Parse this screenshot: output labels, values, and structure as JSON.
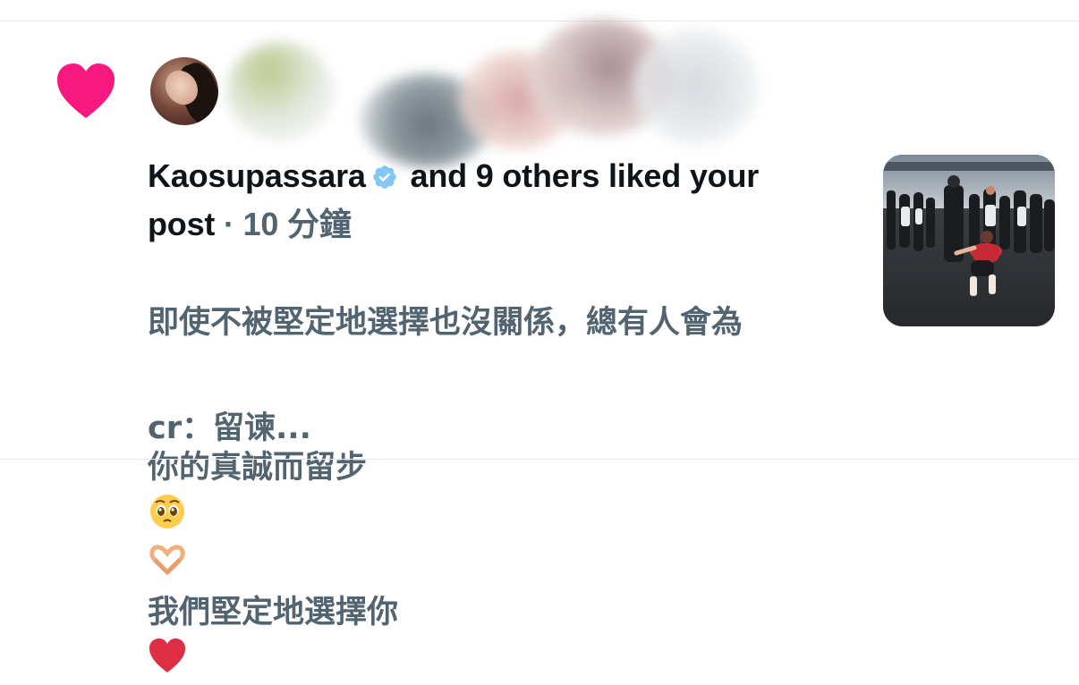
{
  "notification": {
    "type_icon": "heart-icon",
    "accent_color": "#f91880",
    "liker_name": "Kaosupassara",
    "action_text": "and 9 others liked your post",
    "action_prefix": "and 9 others liked your",
    "action_suffix": "post",
    "separator": " · ",
    "timestamp": "10 分鐘",
    "post_text_line1": "即使不被堅定地選擇也沒關係，總有人會為",
    "post_text_line2_a": "你的真誠而留步",
    "post_text_line2_b": "我們堅定地選擇你",
    "credit": "cr：留谏..."
  }
}
